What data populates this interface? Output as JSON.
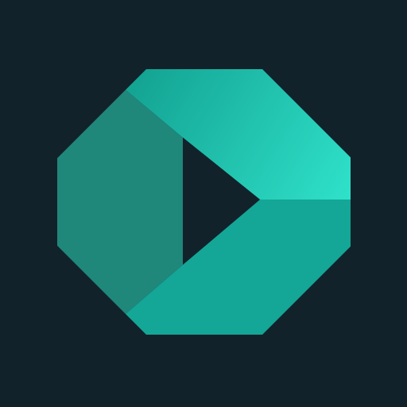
{
  "app_icon": {
    "name": "play-logo",
    "colors": {
      "background": "#12222A",
      "left_panel": "#20877B",
      "top_panel_start": "#14A494",
      "top_panel_end": "#2FE1C9",
      "bottom_panel": "#14A696",
      "play_triangle": "#12222A"
    }
  }
}
